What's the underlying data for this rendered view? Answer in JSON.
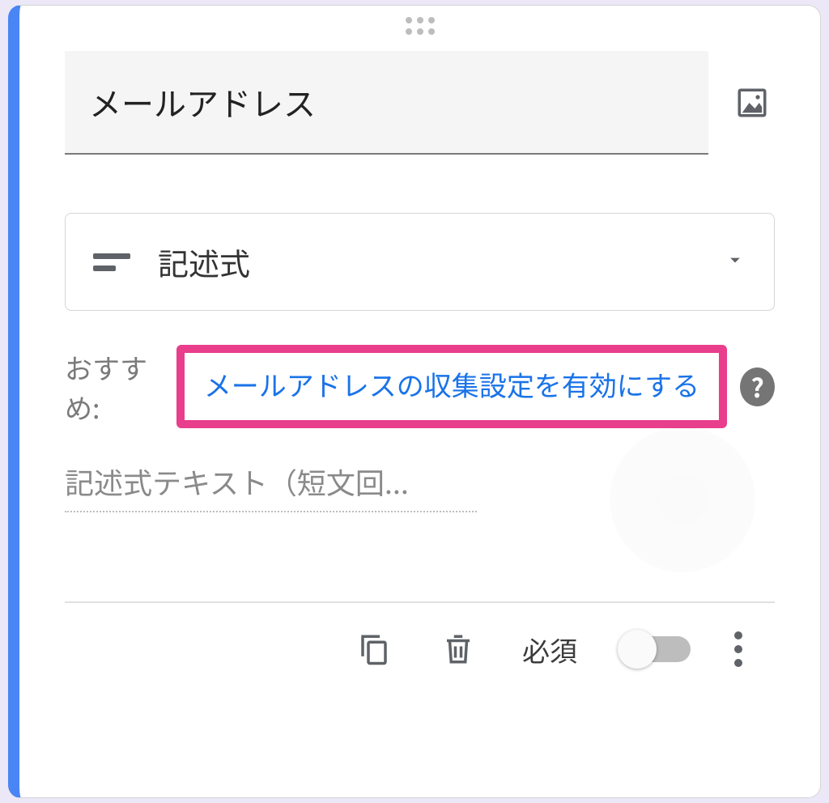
{
  "question": {
    "title": "メールアドレス",
    "type_label": "記述式",
    "answer_placeholder": "記述式テキスト（短文回..."
  },
  "suggestion": {
    "label": "おすすめ:",
    "link_text": "メールアドレスの収集設定を有効にする"
  },
  "footer": {
    "required_label": "必須"
  },
  "icons": {
    "image": "image-icon",
    "short_text": "short-text-icon",
    "dropdown": "dropdown-icon",
    "help": "?",
    "copy": "copy-icon",
    "delete": "delete-icon",
    "more": "more-icon"
  }
}
